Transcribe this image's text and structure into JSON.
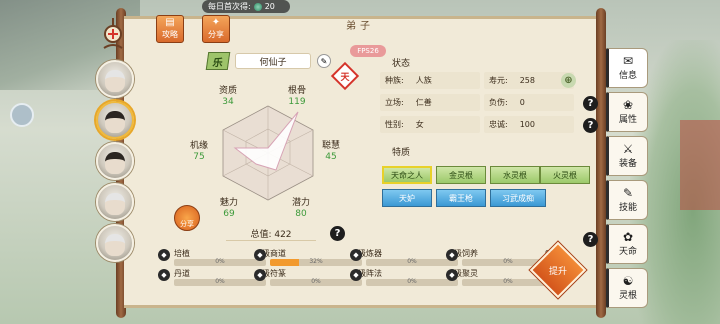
{
  "daily": {
    "label": "每日首次得:",
    "value": "20"
  },
  "top_buttons": [
    {
      "label": "攻略",
      "icon": "book-icon"
    },
    {
      "label": "分享",
      "icon": "share-icon"
    }
  ],
  "panel": {
    "title": "弟子",
    "fps": "FPS26"
  },
  "character": {
    "rank_badge": "乐",
    "name": "何仙子",
    "stamp": "天",
    "stats": [
      {
        "label": "资质",
        "value": "34"
      },
      {
        "label": "根骨",
        "value": "119"
      },
      {
        "label": "聪慧",
        "value": "45"
      },
      {
        "label": "潜力",
        "value": "80"
      },
      {
        "label": "魅力",
        "value": "69"
      },
      {
        "label": "机缘",
        "value": "75"
      }
    ],
    "total": "总值: 422",
    "share_label": "分享"
  },
  "status": {
    "title": "状态",
    "rows": [
      {
        "key": "种族:",
        "value": "人族"
      },
      {
        "key": "寿元:",
        "value": "258"
      },
      {
        "key": "立场:",
        "value": "仁善"
      },
      {
        "key": "负伤:",
        "value": "0"
      },
      {
        "key": "性别:",
        "value": "女"
      },
      {
        "key": "忠诚:",
        "value": "100"
      }
    ]
  },
  "traits": {
    "title": "特质",
    "items": [
      {
        "label": "天命之人",
        "style": "green",
        "selected": true
      },
      {
        "label": "金灵根",
        "style": "green"
      },
      {
        "label": "水灵根",
        "style": "green"
      },
      {
        "label": "火灵根",
        "style": "green"
      },
      {
        "label": "天妒",
        "style": "blue"
      },
      {
        "label": "霸王枪",
        "style": "blue"
      },
      {
        "label": "习武成痴",
        "style": "blue"
      }
    ]
  },
  "skills": [
    {
      "name": "培植",
      "level": "1级",
      "progress": 0,
      "pct": "0%"
    },
    {
      "name": "商道",
      "level": "4级",
      "progress": 32,
      "pct": "32%"
    },
    {
      "name": "炼器",
      "level": "7级",
      "progress": 0,
      "pct": "0%"
    },
    {
      "name": "饲养",
      "level": "0级",
      "progress": 0,
      "pct": "0%"
    },
    {
      "name": "丹道",
      "level": "0级",
      "progress": 0,
      "pct": "0%"
    },
    {
      "name": "符篆",
      "level": "0级",
      "progress": 0,
      "pct": "0%"
    },
    {
      "name": "阵法",
      "level": "0级",
      "progress": 0,
      "pct": "0%"
    },
    {
      "name": "聚灵",
      "level": "1级",
      "progress": 0,
      "pct": "0%"
    }
  ],
  "upgrade_label": "提升",
  "right_tabs": [
    {
      "label": "信息",
      "icon": "info-icon"
    },
    {
      "label": "属性",
      "icon": "attribute-icon"
    },
    {
      "label": "装备",
      "icon": "equipment-icon"
    },
    {
      "label": "技能",
      "icon": "skill-icon"
    },
    {
      "label": "天命",
      "icon": "fate-icon"
    },
    {
      "label": "灵根",
      "icon": "spirit-root-icon"
    }
  ],
  "colors": {
    "accent_orange": "#e3762e",
    "stat_green": "#3d9a3a",
    "paper": "#f1ead8"
  }
}
